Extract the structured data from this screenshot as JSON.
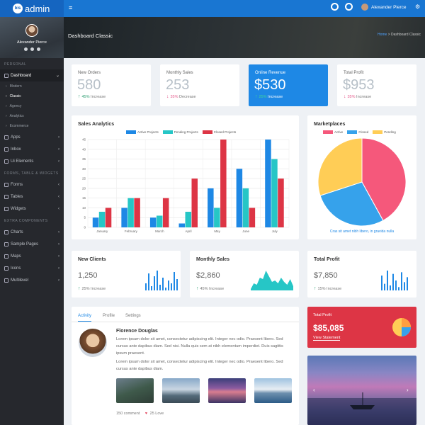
{
  "app": {
    "logo_badge": "bis",
    "logo_text": "admin",
    "menu_icon": "≡"
  },
  "topbar": {
    "user_name": "Alexander Pierce",
    "settings_icon": "⚙"
  },
  "sidebar": {
    "profile_name": "Alexander Pierce",
    "sections": [
      {
        "heading": "PERSONAL"
      },
      {
        "heading": "FORMS, TABLE & WIDGETS"
      },
      {
        "heading": "EXTRA COMPONENTS"
      }
    ],
    "dashboard_label": "Dashboard",
    "sub_items": [
      "Modern",
      "Classic",
      "Agency",
      "Analytics",
      "Ecommerce"
    ],
    "items_a": [
      "Apps",
      "Inbox",
      "Ui Elements"
    ],
    "items_b": [
      "Forms",
      "Tables",
      "Widgets"
    ],
    "items_c": [
      "Charts",
      "Sample Pages",
      "Maps",
      "Icons",
      "Multilevel"
    ]
  },
  "banner": {
    "title": "Dashboard Classic",
    "crumb_home": "Home",
    "crumb_current": "Dashboard Classic"
  },
  "stats": [
    {
      "label": "New Orders",
      "value": "580",
      "pct": "45%",
      "trend": "Increase",
      "dir": "up"
    },
    {
      "label": "Monthly Sales",
      "value": "253",
      "pct": "35%",
      "trend": "Decrease",
      "dir": "down"
    },
    {
      "label": "Online Revenue",
      "value": "$530",
      "pct": "25%",
      "trend": "Increase",
      "dir": "up"
    },
    {
      "label": "Total Profit",
      "value": "$953",
      "pct": "35%",
      "trend": "Increase",
      "dir": "down"
    }
  ],
  "sales_analytics": {
    "title": "Sales Analytics",
    "chart_data": {
      "type": "bar",
      "title": "Sales Analytics",
      "categories": [
        "January",
        "February",
        "March",
        "April",
        "May",
        "June",
        "July"
      ],
      "series": [
        {
          "name": "Active Projects",
          "color": "#1e88e5",
          "values": [
            5,
            10,
            5,
            2,
            20,
            30,
            45
          ]
        },
        {
          "name": "Pending Projects",
          "color": "#26c6c6",
          "values": [
            8,
            15,
            6,
            8,
            10,
            20,
            35
          ]
        },
        {
          "name": "Closed Projects",
          "color": "#dd3545",
          "values": [
            10,
            15,
            15,
            25,
            45,
            10,
            25
          ]
        }
      ],
      "ylim": [
        0,
        45
      ],
      "yticks": [
        0,
        5,
        10,
        15,
        20,
        25,
        30,
        35,
        40,
        45
      ],
      "grid": true,
      "legend": "top"
    }
  },
  "marketplaces": {
    "title": "Marketplaces",
    "caption": "Cras sit amet nibh libero, in gravida nulla",
    "chart_data": {
      "type": "pie",
      "labels": [
        "Active",
        "Closed",
        "Pending"
      ],
      "values": [
        42,
        28,
        30
      ],
      "colors": [
        "#f5587b",
        "#36a2eb",
        "#ffcd56"
      ],
      "legend": "top"
    }
  },
  "small_stats": [
    {
      "title": "New Clients",
      "value": "1,250",
      "note": "25% Increase",
      "bars": [
        5,
        12,
        3,
        10,
        14,
        4,
        9,
        2,
        7,
        5,
        13,
        8
      ]
    },
    {
      "title": "Monthly Sales",
      "value": "$2,860",
      "note": "45% Increase",
      "area": [
        1,
        5,
        4,
        9,
        8,
        14,
        10,
        6,
        7,
        5,
        9,
        6,
        4,
        8,
        3
      ]
    },
    {
      "title": "Total Profit",
      "value": "$7,850",
      "note": "15% Increase",
      "bars": [
        9,
        4,
        12,
        3,
        10,
        6,
        2,
        11,
        5,
        8
      ]
    }
  ],
  "activity": {
    "tabs": [
      "Activity",
      "Profile",
      "Settings"
    ],
    "name": "Florence Douglas",
    "para1": "Lorem ipsum dolor sit amet, consectetur adipiscing elit. Integer nec odio. Praesent libero. Sed cursus ante dapibus diam. Sed nisi. Nulla quis sem at nibh elementum imperdiet. Duis sagittis ipsum praesent.",
    "para2": "Lorem ipsum dolor sit amet, consectetur adipiscing elit. Integer nec odio. Praesent libero. Sed cursus ante dapibus diam.",
    "comments": "150 comment",
    "likes": "25 Love"
  },
  "profit_card": {
    "label": "Total Profit",
    "value": "$85,085",
    "link": "View Statement"
  },
  "carousel": {
    "prev": "‹",
    "next": "›"
  }
}
